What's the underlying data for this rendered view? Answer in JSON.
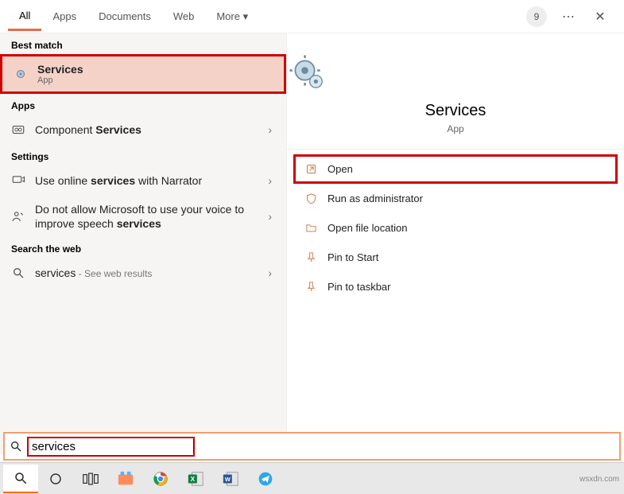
{
  "tabs": {
    "all": "All",
    "apps": "Apps",
    "documents": "Documents",
    "web": "Web",
    "more": "More"
  },
  "header": {
    "badge": "9"
  },
  "sections": {
    "best_match": "Best match",
    "apps": "Apps",
    "settings": "Settings",
    "web": "Search the web"
  },
  "results": {
    "services_title": "Services",
    "services_sub": "App",
    "component_pre": "Component ",
    "component_bold": "Services",
    "narrator_pre": "Use online ",
    "narrator_bold": "services",
    "narrator_post": " with Narrator",
    "speech_pre": "Do not allow Microsoft to use your voice to improve speech ",
    "speech_bold": "services",
    "web_term": "services",
    "web_hint": " - See web results"
  },
  "detail": {
    "title": "Services",
    "sub": "App",
    "actions": {
      "open": "Open",
      "admin": "Run as administrator",
      "location": "Open file location",
      "pin_start": "Pin to Start",
      "pin_taskbar": "Pin to taskbar"
    }
  },
  "search_input": "services",
  "watermark": "wsxdn.com"
}
